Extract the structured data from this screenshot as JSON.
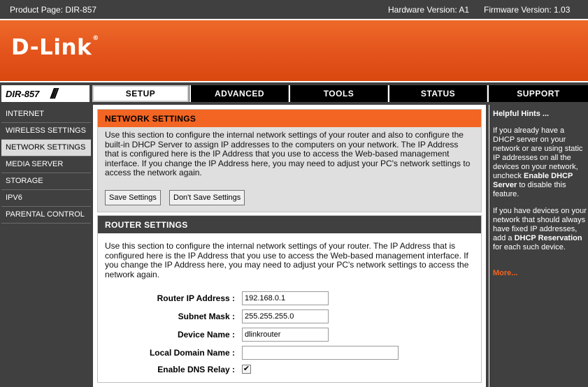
{
  "topbar": {
    "product": "Product Page: DIR-857",
    "hardware": "Hardware Version: A1",
    "firmware": "Firmware Version: 1.03"
  },
  "brand": {
    "logo": "D-Link",
    "registered": "®"
  },
  "nav": {
    "model": "DIR-857",
    "tabs": [
      "SETUP",
      "ADVANCED",
      "TOOLS",
      "STATUS",
      "SUPPORT"
    ],
    "active_tab": "SETUP"
  },
  "sidebar": {
    "items": [
      {
        "label": "INTERNET"
      },
      {
        "label": "WIRELESS SETTINGS"
      },
      {
        "label": "NETWORK SETTINGS"
      },
      {
        "label": "MEDIA SERVER"
      },
      {
        "label": "STORAGE"
      },
      {
        "label": "IPV6"
      },
      {
        "label": "PARENTAL CONTROL"
      }
    ],
    "active": "NETWORK SETTINGS"
  },
  "network_settings": {
    "title": "NETWORK SETTINGS",
    "description": "Use this section to configure the internal network settings of your router and also to configure the built-in DHCP Server to assign IP addresses to the computers on your network. The IP Address that is configured here is the IP Address that you use to access the Web-based management interface. If you change the IP Address here, you may need to adjust your PC's network settings to access the network again.",
    "save_label": "Save Settings",
    "dont_save_label": "Don't Save Settings"
  },
  "router_settings": {
    "title": "ROUTER SETTINGS",
    "description": "Use this section to configure the internal network settings of your router. The IP Address that is configured here is the IP Address that you use to access the Web-based management interface. If you change the IP Address here, you may need to adjust your PC's network settings to access the network again.",
    "fields": {
      "router_ip": {
        "label": "Router IP Address :",
        "value": "192.168.0.1"
      },
      "subnet_mask": {
        "label": "Subnet Mask :",
        "value": "255.255.255.0"
      },
      "device_name": {
        "label": "Device Name :",
        "value": "dlinkrouter"
      },
      "local_domain": {
        "label": "Local Domain Name :",
        "value": ""
      },
      "dns_relay": {
        "label": "Enable DNS Relay :",
        "checked": true
      }
    }
  },
  "hints": {
    "title": "Helpful Hints ...",
    "p1_text": "If you already have a DHCP server on your network or are using static IP addresses on all the devices on your network, uncheck ",
    "p1_bold": "Enable DHCP Server",
    "p1_end": " to disable this feature.",
    "p2_text": "If you have devices on your network that should always have fixed IP addresses, add a ",
    "p2_bold": "DHCP Reservation",
    "p2_end": " for each such device.",
    "more": "More..."
  },
  "colors": {
    "accent": "#f26522",
    "dark": "#404040",
    "panel": "#dfdfdf"
  }
}
